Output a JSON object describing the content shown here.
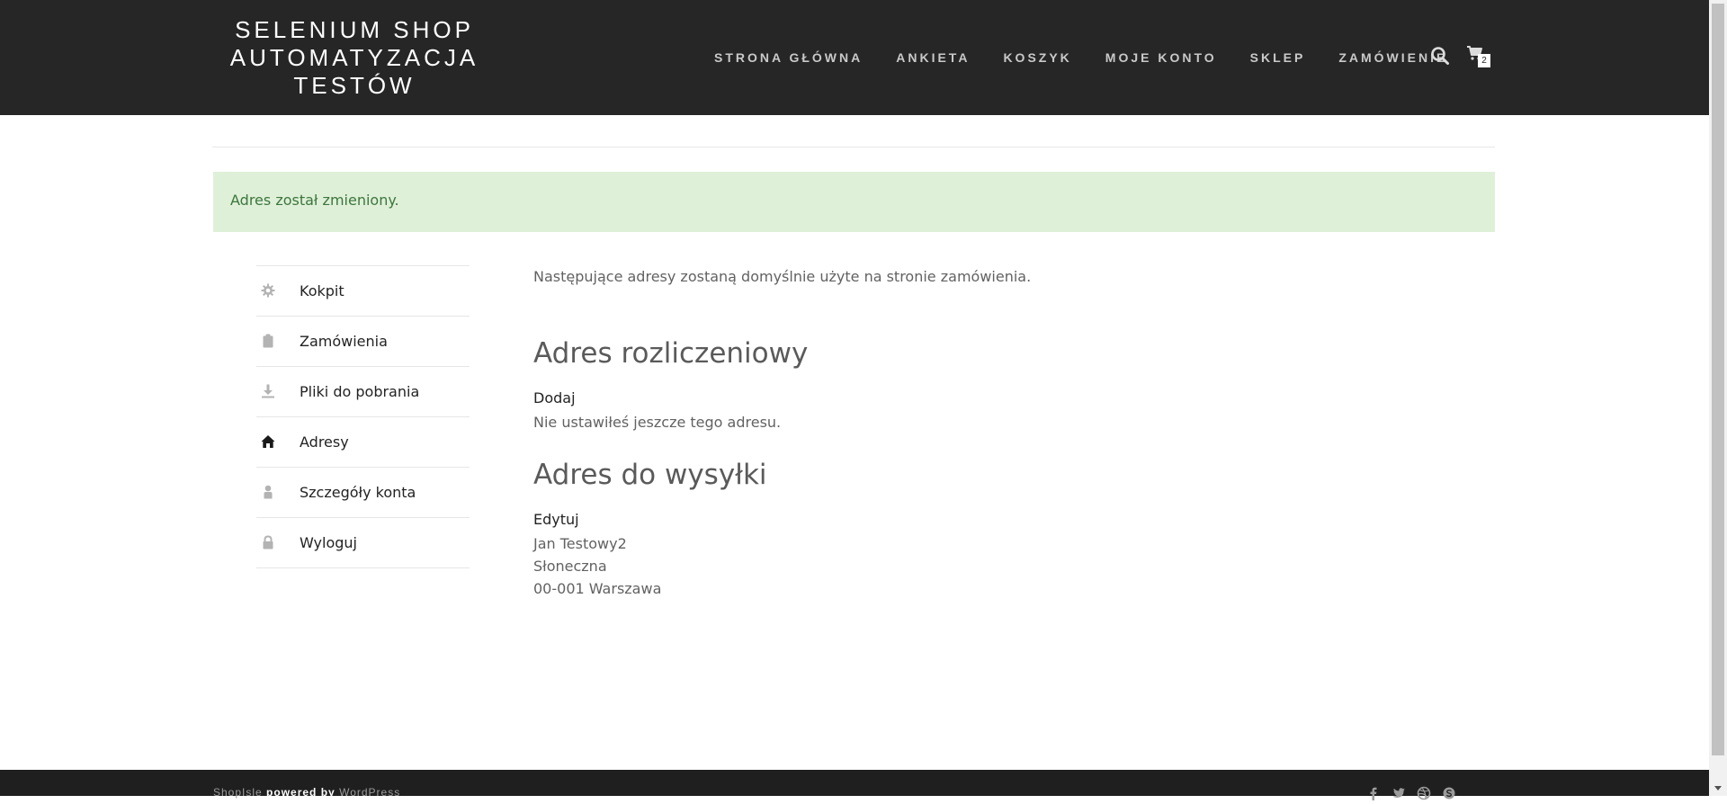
{
  "brand": {
    "line1": "SELENIUM SHOP",
    "line2": "AUTOMATYZACJA",
    "line3": "TESTÓW"
  },
  "nav": {
    "items": [
      {
        "label": "STRONA GŁÓWNA"
      },
      {
        "label": "ANKIETA"
      },
      {
        "label": "KOSZYK"
      },
      {
        "label": "MOJE KONTO"
      },
      {
        "label": "SKLEP"
      },
      {
        "label": "ZAMÓWIENIE"
      }
    ],
    "cart_count": "2",
    "icons": [
      "search-icon",
      "cart-icon"
    ]
  },
  "notice": {
    "text": "Adres został zmieniony."
  },
  "sidebar": {
    "items": [
      {
        "label": "Kokpit",
        "icon": "gear-icon"
      },
      {
        "label": "Zamówienia",
        "icon": "clipboard-icon"
      },
      {
        "label": "Pliki do pobrania",
        "icon": "download-icon"
      },
      {
        "label": "Adresy",
        "icon": "home-icon",
        "active": true
      },
      {
        "label": "Szczegóły konta",
        "icon": "user-icon"
      },
      {
        "label": "Wyloguj",
        "icon": "lock-icon"
      }
    ]
  },
  "content": {
    "intro": "Następujące adresy zostaną domyślnie użyte na stronie zamówienia.",
    "billing": {
      "title": "Adres rozliczeniowy",
      "action": "Dodaj",
      "empty": "Nie ustawiłeś jeszcze tego adresu."
    },
    "shipping": {
      "title": "Adres do wysyłki",
      "action": "Edytuj",
      "lines": [
        "Jan Testowy2",
        "Słoneczna",
        "00-001 Warszawa"
      ]
    }
  },
  "footer": {
    "credit_theme": "ShopIsle",
    "credit_powered": "powered by",
    "credit_wp": "WordPress",
    "social_icons": [
      "facebook-icon",
      "twitter-icon",
      "dribbble-icon",
      "skype-icon"
    ]
  },
  "colors": {
    "header_bg": "#262626",
    "notice_bg": "#dff0d8",
    "notice_text": "#3c763d",
    "footer_bg": "#1f1f1f"
  }
}
